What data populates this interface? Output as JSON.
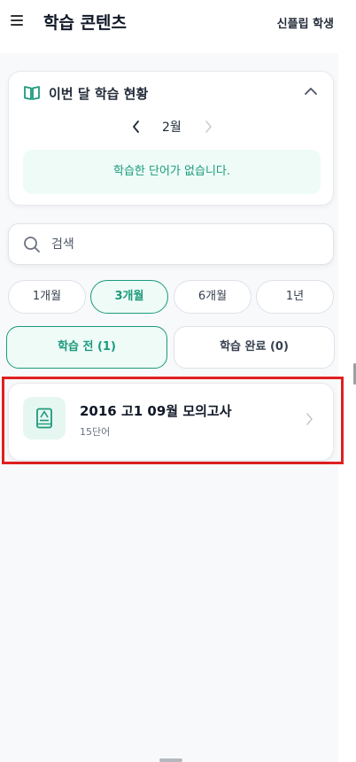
{
  "header": {
    "title": "학습 콘텐츠",
    "user": "신플립 학생"
  },
  "summary": {
    "title": "이번 달 학습 현황",
    "month": "2월",
    "empty_message": "학습한 단어가 없습니다."
  },
  "search": {
    "placeholder": "검색"
  },
  "periods": [
    {
      "label": "1개월",
      "active": false
    },
    {
      "label": "3개월",
      "active": true
    },
    {
      "label": "6개월",
      "active": false
    },
    {
      "label": "1년",
      "active": false
    }
  ],
  "status_tabs": [
    {
      "label": "학습 전 (1)",
      "active": true
    },
    {
      "label": "학습 완료 (0)",
      "active": false
    }
  ],
  "items": [
    {
      "title": "2016 고1 09월 모의고사",
      "count": "15단어"
    }
  ],
  "colors": {
    "accent": "#1c9a7c",
    "accent_bg": "#eefbf6",
    "highlight": "#e02020"
  }
}
